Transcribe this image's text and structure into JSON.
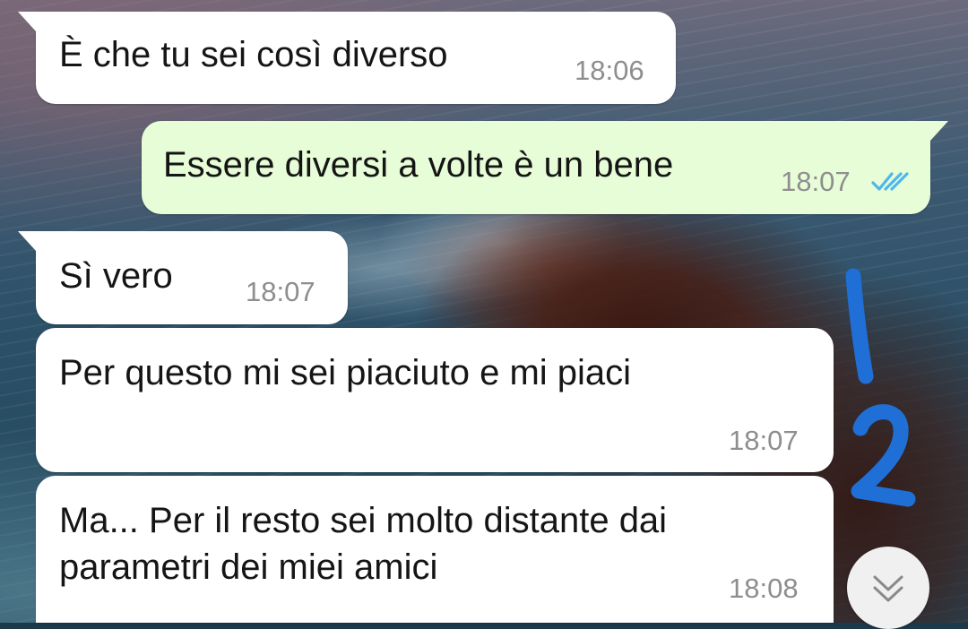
{
  "messages": [
    {
      "text": "È che tu sei così diverso",
      "time": "18:06",
      "direction": "incoming"
    },
    {
      "text": "Essere diversi a volte è un bene",
      "time": "18:07",
      "direction": "outgoing",
      "status_icon": "double-check-read-icon"
    },
    {
      "text": "Sì vero",
      "time": "18:07",
      "direction": "incoming"
    },
    {
      "text": "Per questo mi sei piaciuto e mi piaci",
      "time": "18:07",
      "direction": "incoming"
    },
    {
      "text": "Ma... Per il resto sei molto distante dai\nparametri dei miei amici",
      "time": "18:08",
      "direction": "incoming"
    }
  ],
  "scroll_button": {
    "icon": "double-chevron-down-icon"
  },
  "annotations": [
    "1",
    "2"
  ],
  "colors": {
    "incoming_bubble": "#ffffff",
    "outgoing_bubble": "#e7fdd8",
    "timestamp": "#8e8e8e",
    "read_ticks": "#4fb6ec",
    "annotation_ink": "#1f6fd6"
  }
}
